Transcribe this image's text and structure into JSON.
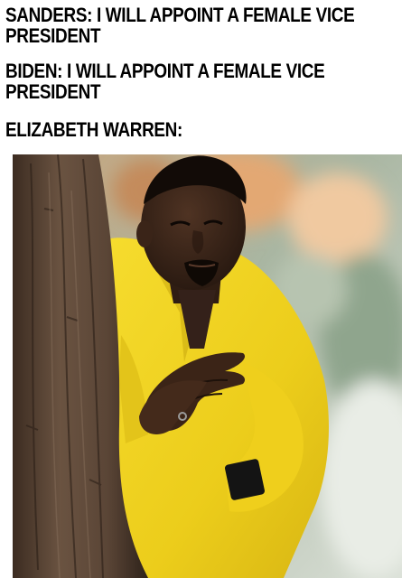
{
  "captions": {
    "line1": "SANDERS: I WILL APPOINT A FEMALE VICE PRESIDENT",
    "line2": "BIDEN: I WILL APPOINT A FEMALE VICE PRESIDENT",
    "line3": "ELIZABETH WARREN:"
  },
  "colors": {
    "background": "#ffffff",
    "text": "#000000",
    "jacket": "#f2d21e",
    "tree_bark": "#5b4636",
    "skin": "#3a2418",
    "background_blur_green": "#9fb39a",
    "background_blur_orange": "#e7a06a"
  }
}
